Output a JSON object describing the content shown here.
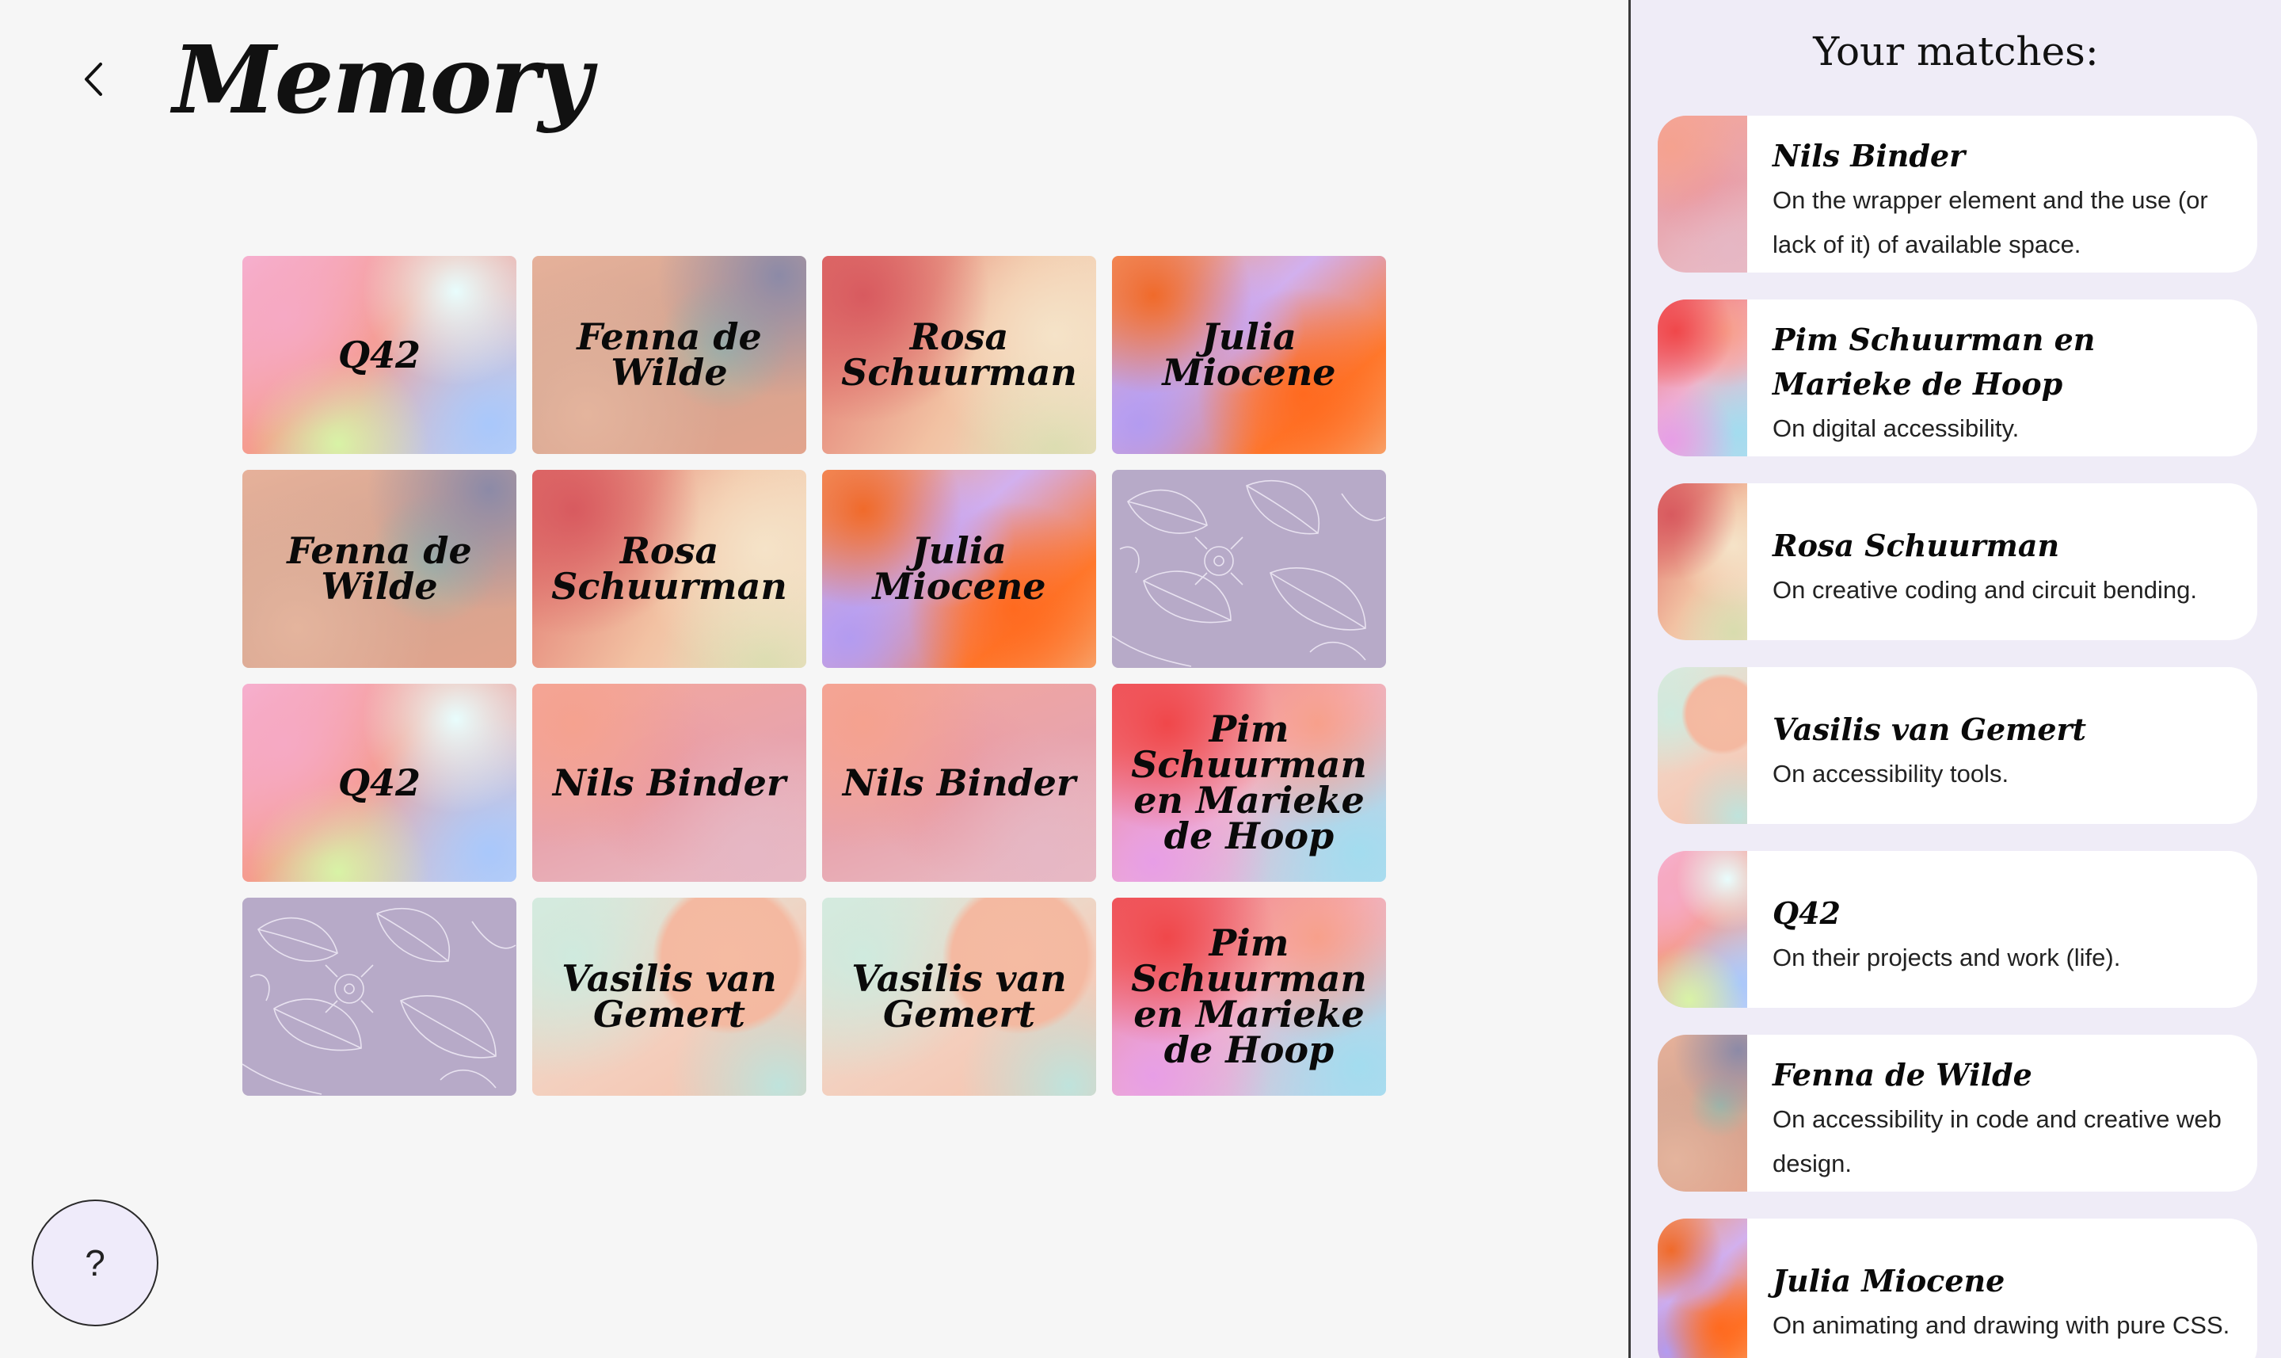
{
  "header": {
    "title": "Memory",
    "back_icon": "chevron-left-icon"
  },
  "board": {
    "cards": [
      {
        "label": "Q42",
        "theme": "q42"
      },
      {
        "label": "Fenna de Wilde",
        "theme": "fenna"
      },
      {
        "label": "Rosa Schuurman",
        "theme": "rosa"
      },
      {
        "label": "Julia Miocene",
        "theme": "julia"
      },
      {
        "label": "Fenna de Wilde",
        "theme": "fenna"
      },
      {
        "label": "Rosa Schuurman",
        "theme": "rosa"
      },
      {
        "label": "Julia Miocene",
        "theme": "julia"
      },
      {
        "label": "",
        "theme": "back"
      },
      {
        "label": "Q42",
        "theme": "q42"
      },
      {
        "label": "Nils Binder",
        "theme": "nils"
      },
      {
        "label": "Nils Binder",
        "theme": "nils"
      },
      {
        "label": "Pim Schuurman en Marieke de Hoop",
        "theme": "pim"
      },
      {
        "label": "",
        "theme": "back"
      },
      {
        "label": "Vasilis van Gemert",
        "theme": "vasilis"
      },
      {
        "label": "Vasilis van Gemert",
        "theme": "vasilis"
      },
      {
        "label": "Pim Schuurman en Marieke de Hoop",
        "theme": "pim"
      }
    ]
  },
  "help": {
    "label": "?"
  },
  "sidebar": {
    "title": "Your matches:",
    "matches": [
      {
        "name": "Nils Binder",
        "description": "On the wrapper element and the use (or lack of it) of available space.",
        "theme": "nils"
      },
      {
        "name": "Pim Schuurman en Marieke de Hoop",
        "description": "On digital accessibility.",
        "theme": "pim"
      },
      {
        "name": "Rosa Schuurman",
        "description": "On creative coding and circuit bending.",
        "theme": "rosa"
      },
      {
        "name": "Vasilis van Gemert",
        "description": "On accessibility tools.",
        "theme": "vasilis"
      },
      {
        "name": "Q42",
        "description": "On their projects and work (life).",
        "theme": "q42"
      },
      {
        "name": "Fenna de Wilde",
        "description": "On accessibility in code and creative web design.",
        "theme": "fenna"
      },
      {
        "name": "Julia Miocene",
        "description": "On animating and drawing with pure CSS.",
        "theme": "julia"
      }
    ]
  },
  "colors": {
    "background": "#f6f6f6",
    "sidebar": "#efecf7",
    "card_back": "#b7aac8",
    "help_button": "#efebfa"
  }
}
